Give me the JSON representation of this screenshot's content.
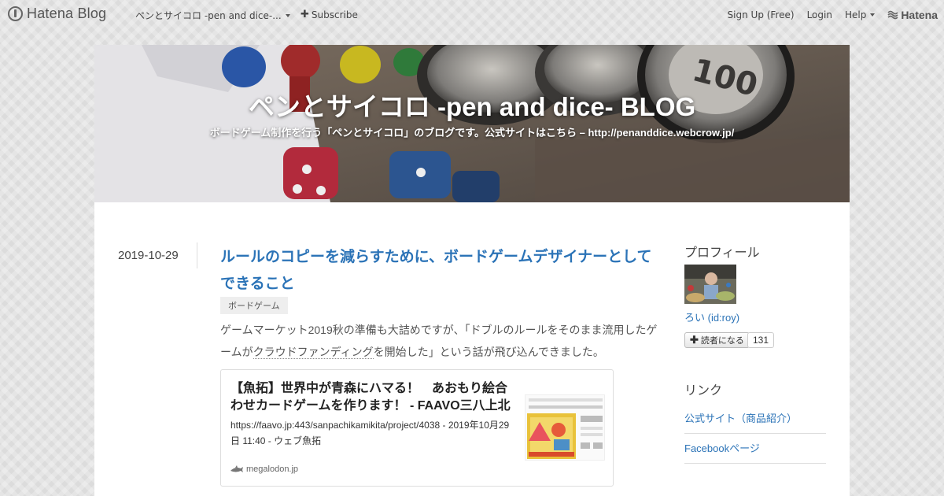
{
  "global_header": {
    "logo_text": "Hatena Blog",
    "blog_menu_label": "ペンとサイコロ -pen and dice-...",
    "subscribe_label": "Subscribe",
    "signup_label": "Sign Up (Free)",
    "login_label": "Login",
    "help_label": "Help",
    "hatena_label": "Hatena"
  },
  "blog": {
    "title": "ペンとサイコロ -pen and dice- BLOG",
    "description": "ボードゲーム制作を行う「ペンとサイコロ」のブログです。公式サイトはこちら – http://penanddice.webcrow.jp/"
  },
  "entry": {
    "date": "2019-10-29",
    "title": "ルールのコピーを減らすために、ボードゲームデザイナーとしてできること",
    "category": "ボードゲーム",
    "body_parts": [
      "ゲームマーケット2019秋の準備も大詰めですが、「ドブルのルールをそのまま流用したゲームが",
      "クラウドファンディング",
      "を開始した」という話が飛び込んできました。"
    ],
    "embed": {
      "title": "【魚拓】世界中が青森にハマる！　あおもり絵合わせカードゲームを作ります！ - FAAVO三八上北",
      "description": "https://faavo.jp:443/sanpachikamikita/project/4038 - 2019年10月29日 11:40 - ウェブ魚拓",
      "site": "megalodon.jp"
    }
  },
  "sidebar": {
    "profile_heading": "プロフィール",
    "user_name": "ろい (id:roy)",
    "reader_button_label": "読者になる",
    "reader_count": "131",
    "links_heading": "リンク",
    "links": [
      "公式サイト（商品紹介）",
      "Facebookページ"
    ]
  },
  "colors": {
    "link": "#2b73b7",
    "header_text": "#444444"
  }
}
